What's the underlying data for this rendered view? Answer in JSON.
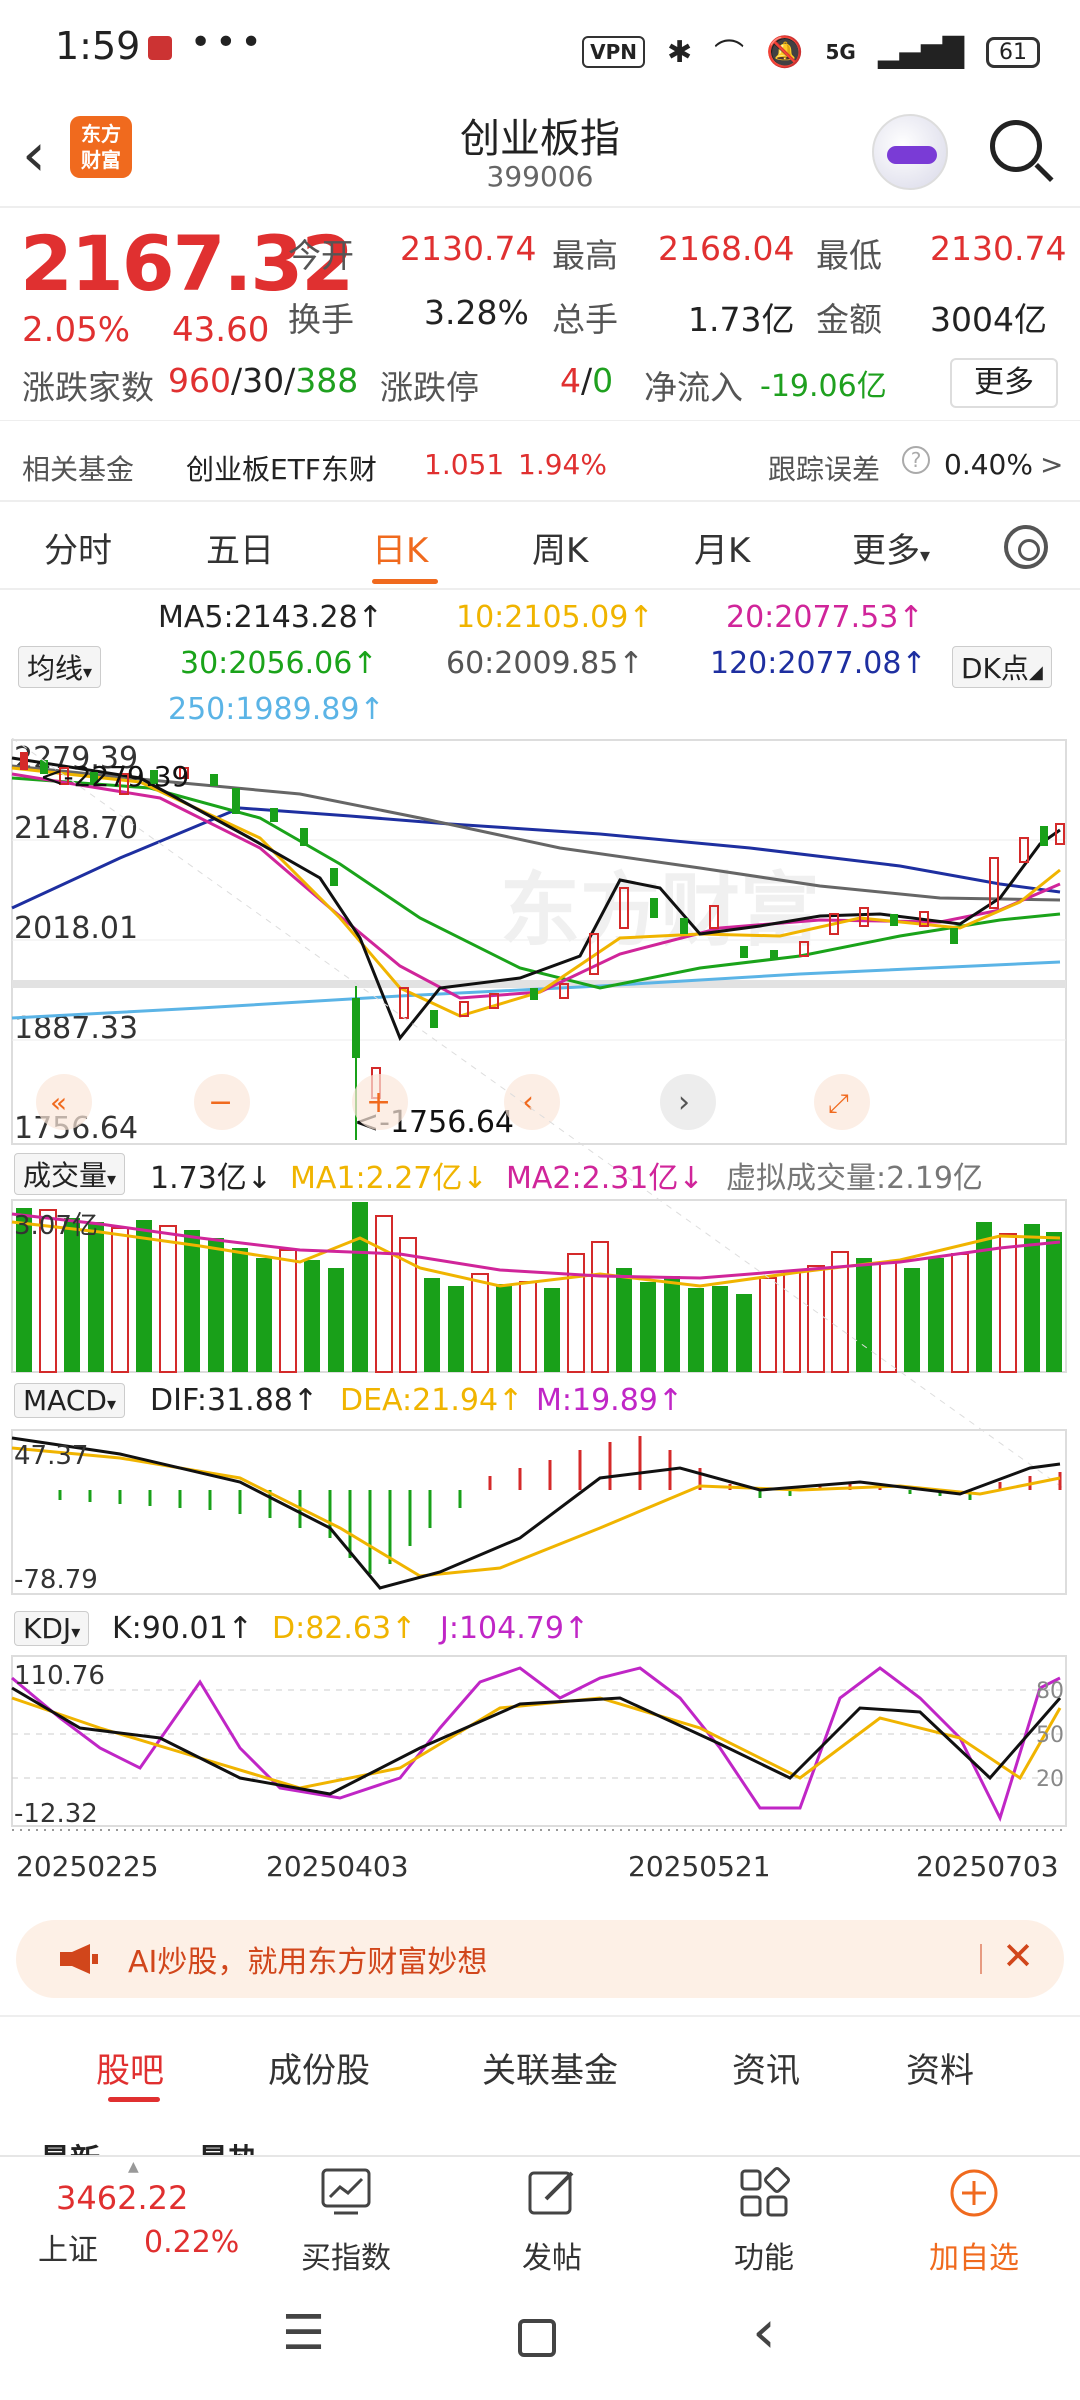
{
  "status": {
    "time": "1:59",
    "dots": "•••",
    "vpn": "VPN",
    "network": "5G",
    "battery": "61"
  },
  "header": {
    "logo_line1": "东方",
    "logo_line2": "财富",
    "title": "创业板指",
    "code": "399006"
  },
  "quote": {
    "price": "2167.32",
    "pct": "2.05%",
    "change": "43.60",
    "open_label": "今开",
    "open": "2130.74",
    "high_label": "最高",
    "high": "2168.04",
    "low_label": "最低",
    "low": "2130.74",
    "turnover_label": "换手",
    "turnover": "3.28%",
    "volume_label": "总手",
    "volume": "1.73亿",
    "amount_label": "金额",
    "amount": "3004亿",
    "breadth_label": "涨跌家数",
    "up": "960",
    "flat": "30",
    "down": "388",
    "limit_label": "涨跌停",
    "limit_up": "4",
    "limit_down": "0",
    "inflow_label": "净流入",
    "inflow": "-19.06亿",
    "more": "更多"
  },
  "fund": {
    "label": "相关基金",
    "name": "创业板ETF东财",
    "price": "1.051",
    "pct": "1.94%",
    "err_label": "跟踪误差",
    "err": "0.40%",
    "arrow": ">"
  },
  "tabs": [
    "分时",
    "五日",
    "日K",
    "周K",
    "月K",
    "更多"
  ],
  "ma_legend": {
    "type": "均线",
    "ma5": "MA5:2143.28↑",
    "ma10": "10:2105.09↑",
    "ma20": "20:2077.53↑",
    "ma30": "30:2056.06↑",
    "ma60": "60:2009.85↑",
    "ma120": "120:2077.08↑",
    "ma250": "250:1989.89↑",
    "dk": "DK点"
  },
  "colors": {
    "ma5": "#111111",
    "ma10": "#f0b400",
    "ma20": "#d0259a",
    "ma30": "#1aa31a",
    "ma60": "#666666",
    "ma120": "#1e2fa0",
    "ma250": "#5bb4e6",
    "up": "#d42a2a",
    "down": "#19a019"
  },
  "kline": {
    "ticks": [
      "2279.39",
      "2148.70",
      "2018.01",
      "1887.33",
      "1756.64"
    ],
    "high_mark": "<-2279.39",
    "low_mark": "<-1756.64"
  },
  "volume": {
    "type": "成交量",
    "value": "1.73亿↓",
    "ma1": "MA1:2.27亿↓",
    "ma2": "MA2:2.31亿↓",
    "virtual": "虚拟成交量:2.19亿",
    "tick": "3.07亿"
  },
  "macd": {
    "type": "MACD",
    "dif": "DIF:31.88↑",
    "dea": "DEA:21.94↑",
    "m": "M:19.89↑",
    "top": "47.37",
    "bottom": "-78.79"
  },
  "kdj": {
    "type": "KDJ",
    "k": "K:90.01↑",
    "d": "D:82.63↑",
    "j": "J:104.79↑",
    "top": "110.76",
    "bottom": "-12.32",
    "l80": "80",
    "l50": "50",
    "l20": "20"
  },
  "dates": [
    "20250225",
    "20250403",
    "20250521",
    "20250703"
  ],
  "ai_banner": "AI炒股，就用东方财富妙想",
  "bottom_tabs": [
    "股吧",
    "成份股",
    "关联基金",
    "资讯",
    "资料"
  ],
  "sub_tabs": [
    "最新",
    "最热"
  ],
  "bottom_bar": {
    "index_value": "3462.22",
    "index_name": "上证",
    "index_pct": "0.22%",
    "buy": "买指数",
    "post": "发帖",
    "func": "功能",
    "add": "加自选"
  }
}
